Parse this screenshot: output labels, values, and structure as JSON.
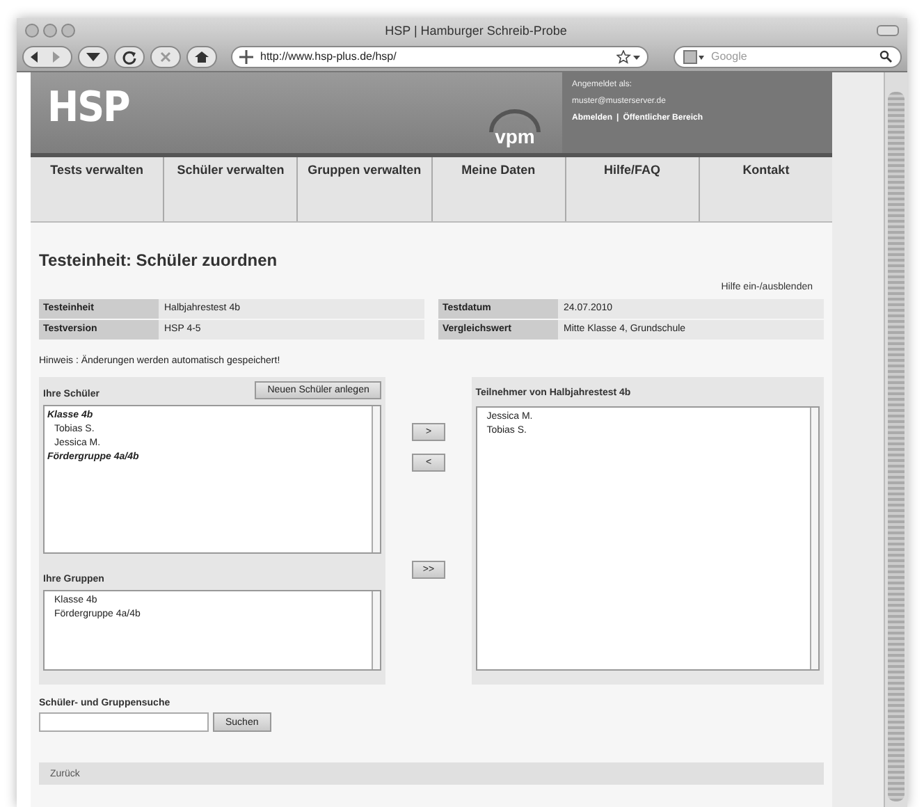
{
  "window": {
    "title": "HSP | Hamburger Schreib-Probe"
  },
  "toolbar": {
    "url": "http://www.hsp-plus.de/hsp/",
    "search_placeholder": "Google"
  },
  "header": {
    "logo": "HSP",
    "publisher": "vpm",
    "login_label": "Angemeldet als:",
    "login_email": "muster@musterserver.de",
    "links": [
      "Abmelden",
      "Öffentlicher Bereich"
    ],
    "separator": "|"
  },
  "nav": [
    "Tests verwalten",
    "Schüler verwalten",
    "Gruppen verwalten",
    "Meine Daten",
    "Hilfe/FAQ",
    "Kontakt"
  ],
  "heading": "Testeinheit: Schüler zuordnen",
  "help_toggle": "Hilfe ein-/ausblenden",
  "info_left": [
    {
      "label": "Testeinheit",
      "value": "Halbjahrestest 4b"
    },
    {
      "label": "Testversion",
      "value": "HSP 4-5"
    }
  ],
  "info_right": [
    {
      "label": "Testdatum",
      "value": "24.07.2010"
    },
    {
      "label": "Vergleichswert",
      "value": "Mitte Klasse 4, Grundschule"
    }
  ],
  "hint": "Hinweis : Änderungen werden automatisch gespeichert!",
  "students_panel": {
    "title": "Ihre Schüler",
    "new_button": "Neuen Schüler anlegen",
    "items": [
      {
        "kind": "group",
        "label": "Klasse 4b"
      },
      {
        "kind": "student",
        "label": "Tobias S."
      },
      {
        "kind": "student",
        "label": "Jessica M."
      },
      {
        "kind": "group",
        "label": "Fördergruppe 4a/4b"
      }
    ]
  },
  "groups_panel": {
    "title": "Ihre Gruppen",
    "items": [
      "Klasse 4b",
      "Fördergruppe 4a/4b"
    ]
  },
  "move_buttons": [
    ">",
    "<"
  ],
  "move_all_button": ">>",
  "participants_panel": {
    "title": "Teilnehmer von Halbjahrestest 4b",
    "items": [
      "Jessica M.",
      "Tobias S."
    ]
  },
  "search": {
    "label": "Schüler- und Gruppensuche",
    "button": "Suchen"
  },
  "back": "Zurück"
}
